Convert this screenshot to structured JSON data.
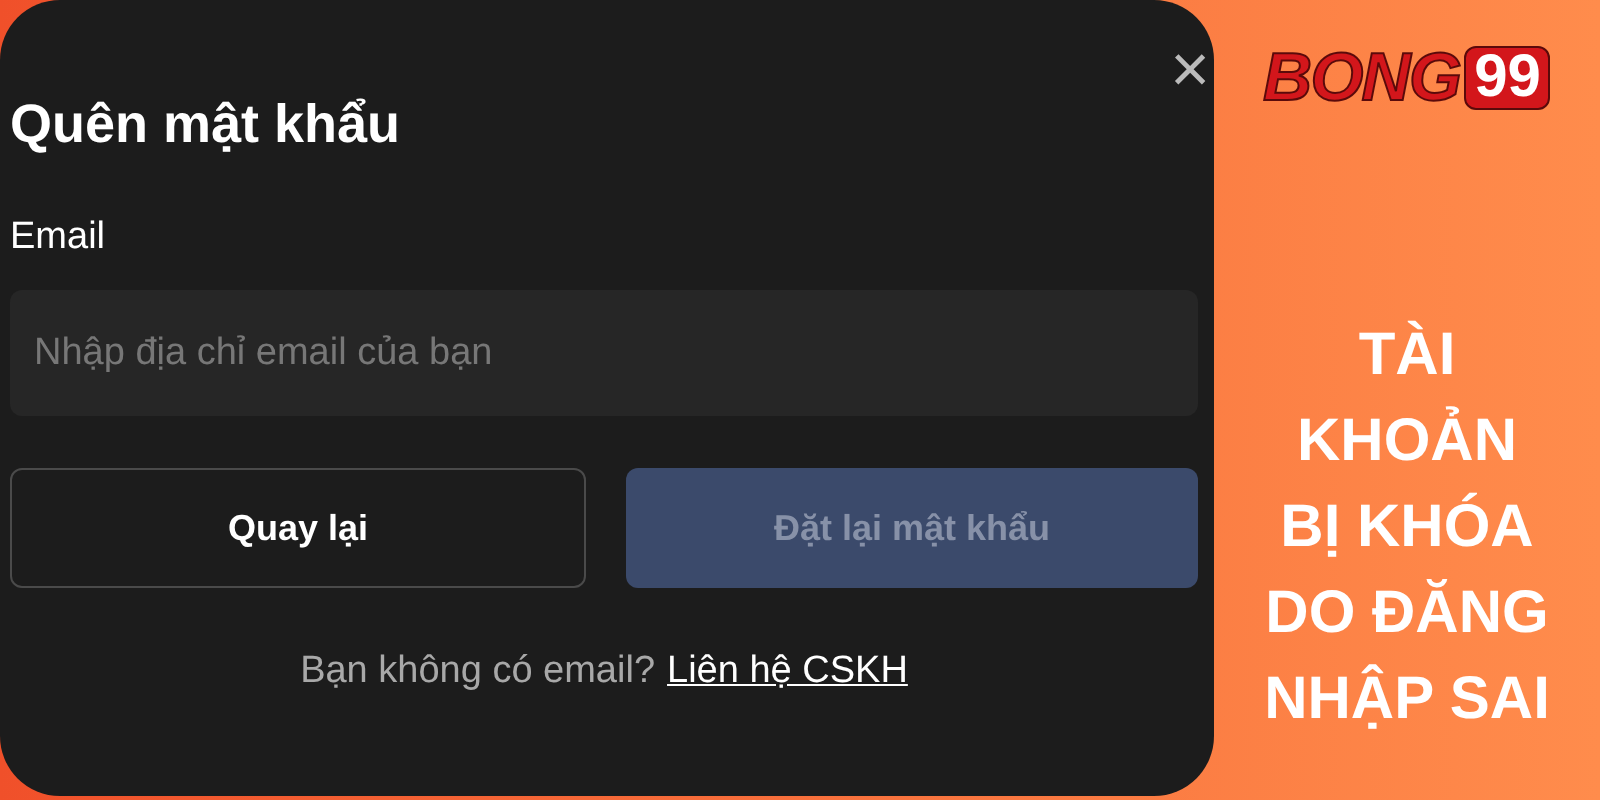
{
  "dialog": {
    "title": "Quên mật khẩu",
    "close": "×",
    "field": {
      "label": "Email",
      "placeholder": "Nhập địa chỉ email của bạn"
    },
    "buttons": [
      {
        "label": "Quay lại",
        "kind": "outline",
        "disabled": false
      },
      {
        "label": "Đặt lại mật khẩu",
        "kind": "primary",
        "disabled": true
      }
    ],
    "footer": {
      "text": "Bạn không có email?",
      "link": "Liên hệ CSKH"
    }
  },
  "banner": {
    "logo": {
      "word": "BONG",
      "number": "99"
    },
    "headline": [
      "TÀI",
      "KHOẢN",
      "BỊ KHÓA",
      "DO ĐĂNG",
      "NHẬP SAI"
    ]
  }
}
